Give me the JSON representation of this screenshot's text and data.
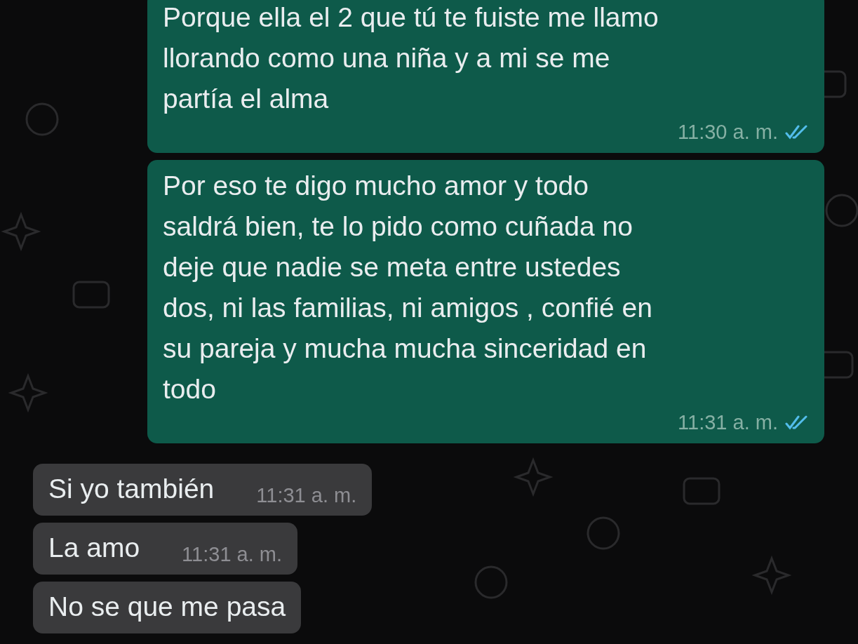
{
  "messages": [
    {
      "kind": "out",
      "text": "Porque ella el 2 que tú te fuiste me llamo\nllorando como una niña y a mi se me\npartía el alma",
      "time": "11:30 a. m.",
      "read": true
    },
    {
      "kind": "out",
      "text": "Por eso te digo mucho amor y todo\nsaldrá bien, te lo pido como cuñada no\ndeje que nadie se meta entre ustedes\ndos, ni las familias, ni amigos , confié en\nsu pareja y mucha mucha sinceridad en\ntodo",
      "time": "11:31 a. m.",
      "read": true
    },
    {
      "kind": "in",
      "text": "Si yo también",
      "time": "11:31 a. m."
    },
    {
      "kind": "in",
      "text": "La amo",
      "time": "11:31 a. m."
    },
    {
      "kind": "in",
      "text": "No se que me pasa"
    }
  ]
}
